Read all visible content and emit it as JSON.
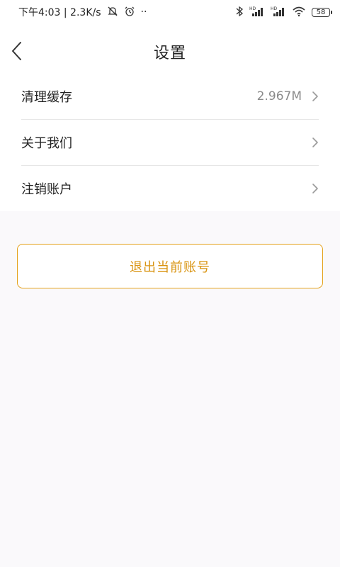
{
  "status_bar": {
    "time_network": "下午4:03 | 2.3K/s",
    "dots": "··",
    "battery": "58",
    "icons": [
      "mute-icon",
      "alarm-icon",
      "bluetooth-icon",
      "signal-hd-icon",
      "signal-hd-icon",
      "wifi-icon",
      "battery-icon"
    ]
  },
  "header": {
    "title": "设置",
    "back_icon": "chevron-left-icon"
  },
  "settings": {
    "items": [
      {
        "label": "清理缓存",
        "value": "2.967M"
      },
      {
        "label": "关于我们",
        "value": ""
      },
      {
        "label": "注销账户",
        "value": ""
      }
    ]
  },
  "actions": {
    "logout_label": "退出当前账号"
  },
  "colors": {
    "accent": "#e4a11b",
    "accent_text": "#d99412",
    "background": "#faf9fb",
    "divider": "#e6e6e6"
  }
}
